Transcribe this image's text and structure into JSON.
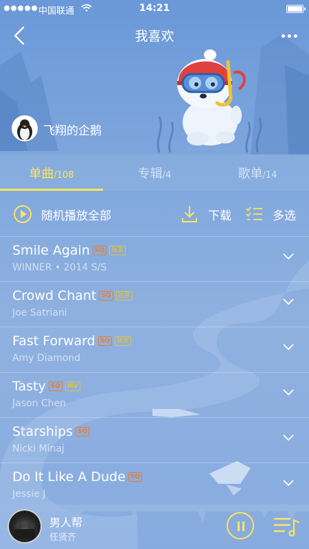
{
  "status_bar": {
    "carrier": "中国联通",
    "time": "14:21"
  },
  "header": {
    "title": "我喜欢"
  },
  "profile": {
    "username": "飞翔的企鹅"
  },
  "tabs": [
    {
      "label": "单曲",
      "count": "/108"
    },
    {
      "label": "专辑",
      "count": "/4"
    },
    {
      "label": "歌单",
      "count": "/14"
    }
  ],
  "actions": {
    "play_all": "随机播放全部",
    "download": "下载",
    "multi_select": "多选"
  },
  "songs": [
    {
      "title": "Smile Again",
      "subtitle": "WINNER • 2014 S/S",
      "badges": [
        "SQ",
        "独家"
      ]
    },
    {
      "title": "Crowd Chant",
      "subtitle": "Joe Satriani",
      "badges": [
        "SQ",
        "独家"
      ]
    },
    {
      "title": "Fast Forward",
      "subtitle": "Amy Diamond",
      "badges": [
        "SQ",
        "独家"
      ]
    },
    {
      "title": "Tasty",
      "subtitle": "Jason Chen",
      "badges": [
        "SQ",
        "MV"
      ]
    },
    {
      "title": "Starships",
      "subtitle": "Nicki Minaj",
      "badges": [
        "SQ"
      ]
    },
    {
      "title": "Do It Like A Dude",
      "subtitle": "Jessie J",
      "badges": [
        "SQ"
      ]
    }
  ],
  "now_playing": {
    "title": "男人帮",
    "artist": "任贤齐"
  },
  "colors": {
    "accent": "#ffe55c",
    "sq_badge": "#f07b2a",
    "exclusive_badge": "#e6c23a"
  }
}
